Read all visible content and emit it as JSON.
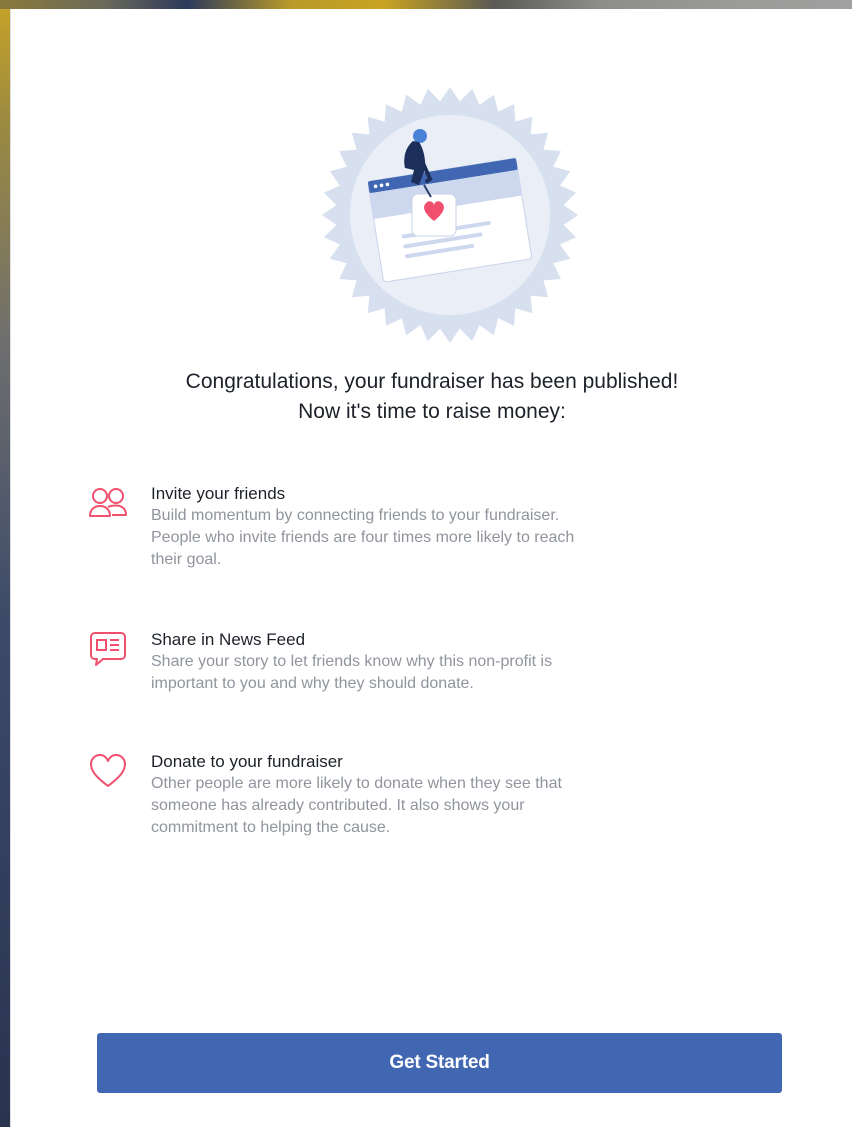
{
  "modal": {
    "heading_line1": "Congratulations, your fundraiser has been published!",
    "heading_line2": "Now it's time to raise money:",
    "illustration_icon": "fundraiser-published-badge-illustration"
  },
  "tips": [
    {
      "icon": "friends-icon",
      "title": "Invite your friends",
      "desc_lines": [
        "Build momentum by connecting friends to your fundraiser.",
        "People who invite friends are four times more likely to reach",
        "their goal."
      ]
    },
    {
      "icon": "news-feed-icon",
      "title": "Share in News Feed",
      "desc_lines": [
        "Share your story to let friends know why this non-profit is",
        "important to you and why they should donate."
      ]
    },
    {
      "icon": "heart-icon",
      "title": "Donate to your fundraiser",
      "desc_lines": [
        "Other people are more likely to donate when they see that",
        "someone has already contributed. It also shows your",
        "commitment to helping the cause."
      ]
    }
  ],
  "cta": {
    "label": "Get Started"
  },
  "colors": {
    "accent": "#4267b2",
    "icon_pink": "#f0506e",
    "title_text": "#1d2129",
    "muted_text": "#90949c"
  }
}
